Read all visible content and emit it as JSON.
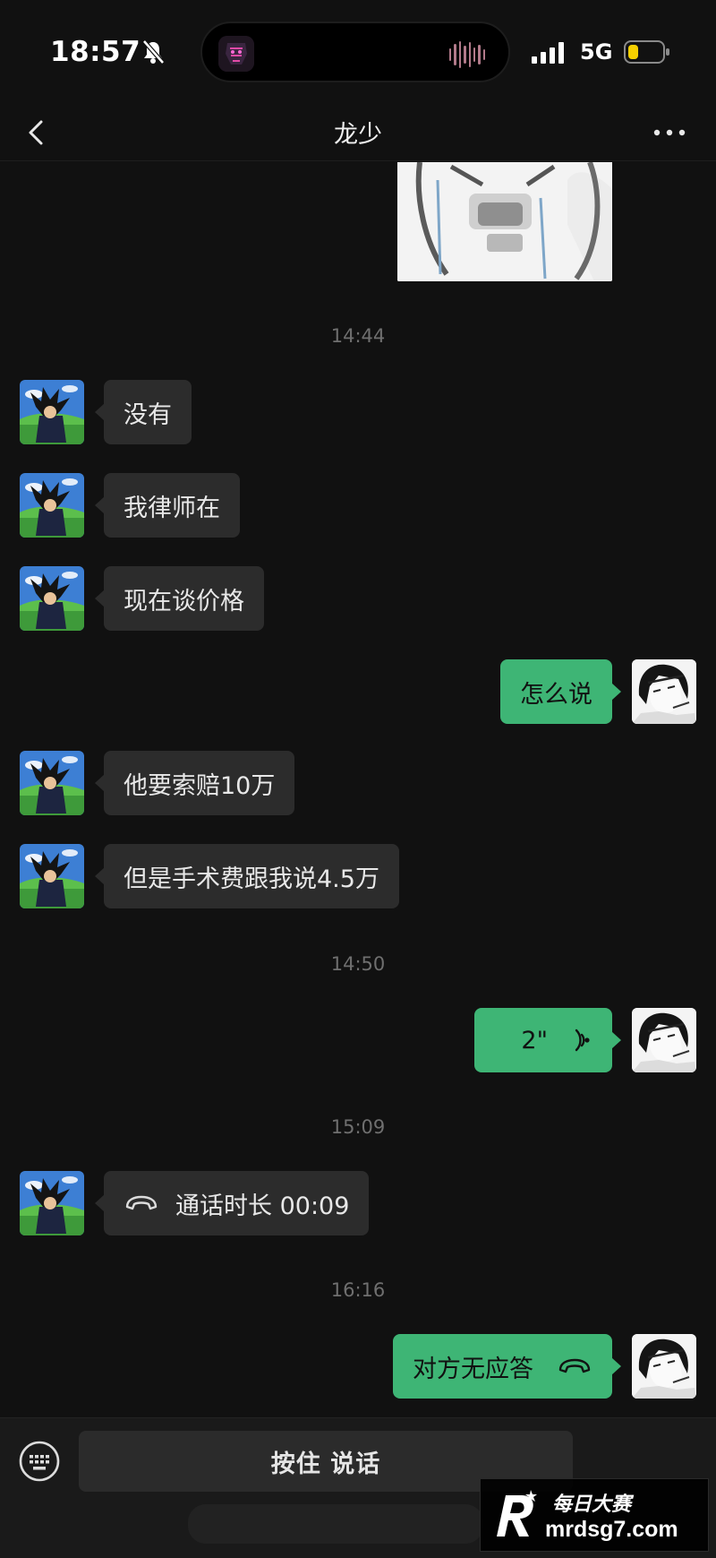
{
  "status_bar": {
    "time": "18:57",
    "network": "5G"
  },
  "header": {
    "title": "龙少"
  },
  "messages": {
    "m1": "没有",
    "m2": "我律师在",
    "m3": "现在谈价格",
    "m4": "怎么说",
    "m5": "他要索赔10万",
    "m6": "但是手术费跟我说4.5万",
    "m7_voice_duration": "2\"",
    "m8_call": "通话时长 00:09",
    "m9_call": "对方无应答"
  },
  "timestamps": {
    "t1": "14:44",
    "t2": "14:50",
    "t3": "15:09",
    "t4": "16:16"
  },
  "input_bar": {
    "hold_to_talk": "按住 说话"
  },
  "watermark": {
    "top": "每日大赛",
    "bottom": "mrdsg7.com"
  },
  "colors": {
    "background": "#111111",
    "bubble_in": "#2c2c2c",
    "bubble_out": "#3eb575",
    "timestamp": "#6f6f6f"
  },
  "icons": {
    "back": "chevron-left-icon",
    "more": "more-dots-icon",
    "keyboard": "keyboard-icon",
    "call": "phone-hangup-icon",
    "voice": "voice-wave-icon"
  }
}
